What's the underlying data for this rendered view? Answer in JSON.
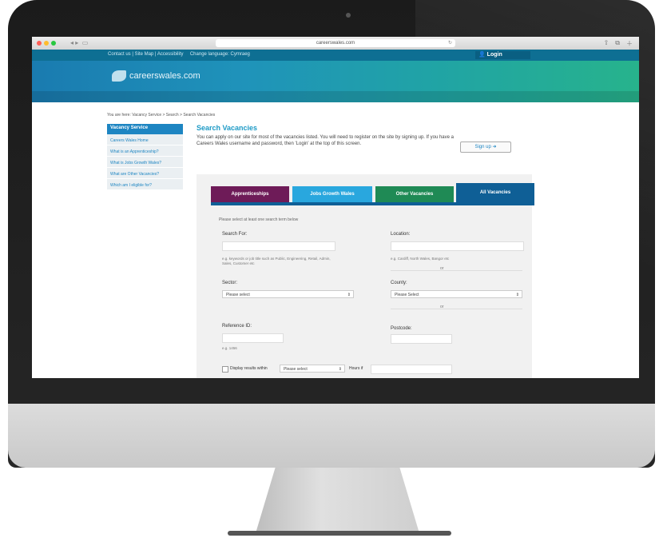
{
  "browser": {
    "url": "careerswales.com",
    "reload_icon": "reload-icon",
    "traffic_colors": [
      "#ff5f57",
      "#febc2e",
      "#28c840"
    ]
  },
  "topbar": {
    "links": "Contact us | Site Map | Accessibility",
    "language": "Change language: Cymraeg",
    "login_label": "Login"
  },
  "brand": {
    "logo_text": "careerswales.com"
  },
  "breadcrumb": "You are here: Vacancy Service > Search > Search Vacancies",
  "sidebar": {
    "heading": "Vacancy Service",
    "items": [
      {
        "label": "Careers Wales Home"
      },
      {
        "label": "What is an Apprenticeship?"
      },
      {
        "label": "What is Jobs Growth Wales?"
      },
      {
        "label": "What are Other Vacancies?"
      },
      {
        "label": "Which am I eligible for?"
      }
    ]
  },
  "main": {
    "title": "Search Vacancies",
    "intro": "You can apply on our site for most of the vacancies listed. You will need to register on the site by signing up. If you have a Careers Wales username and password, then 'Login' at the top of this screen.",
    "signup_label": "Sign up"
  },
  "tabs": [
    {
      "label": "Apprenticeships",
      "color": "#6e1b58"
    },
    {
      "label": "Jobs Growth Wales",
      "color": "#29a7de"
    },
    {
      "label": "Other Vacancies",
      "color": "#1f8a55"
    },
    {
      "label": "All Vacancies",
      "color": "#0f5f96"
    }
  ],
  "form": {
    "hint": "Please select at least one search term below",
    "search_for_label": "Search For:",
    "search_for_help": "e.g. keywords or job title such as Public, Engineering, Retail, Admin, Sales, Customer etc",
    "location_label": "Location:",
    "location_help": "e.g. Cardiff, North Wales, Bangor etc",
    "or1": "or",
    "sector_label": "Sector:",
    "sector_value": "Please select",
    "county_label": "County:",
    "county_value": "Please Select",
    "or2": "or",
    "reference_label": "Reference ID:",
    "reference_help": "e.g. 1456",
    "postcode_label": "Postcode:",
    "display_label": "Display results within",
    "display_value": "Please select",
    "hours_label": "Hours if"
  }
}
